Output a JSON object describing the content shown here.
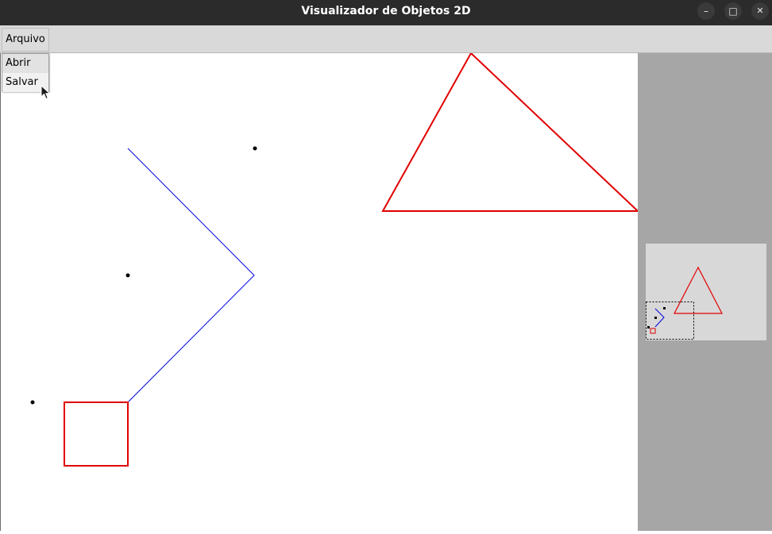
{
  "window": {
    "title": "Visualizador de Objetos 2D",
    "minimize_glyph": "–",
    "maximize_glyph": "□",
    "close_glyph": "✕"
  },
  "menubar": {
    "menus": [
      {
        "label": "Arquivo"
      }
    ]
  },
  "dropdown": {
    "items": [
      {
        "label": "Abrir"
      },
      {
        "label": "Salvar"
      }
    ]
  },
  "icons": {
    "minimize": "minimize-icon",
    "maximize": "maximize-icon",
    "close": "close-icon",
    "cursor": "mouse-pointer-icon"
  },
  "colors": {
    "titlebar": "#2b2b2b",
    "menubar": "#d9d9d9",
    "canvas_background": "#ffffff",
    "side_panel": "#a6a6a6",
    "minimap_background": "#d8d8d8",
    "polygon": "#e00000",
    "line": "#0000e0",
    "point": "#000000"
  }
}
